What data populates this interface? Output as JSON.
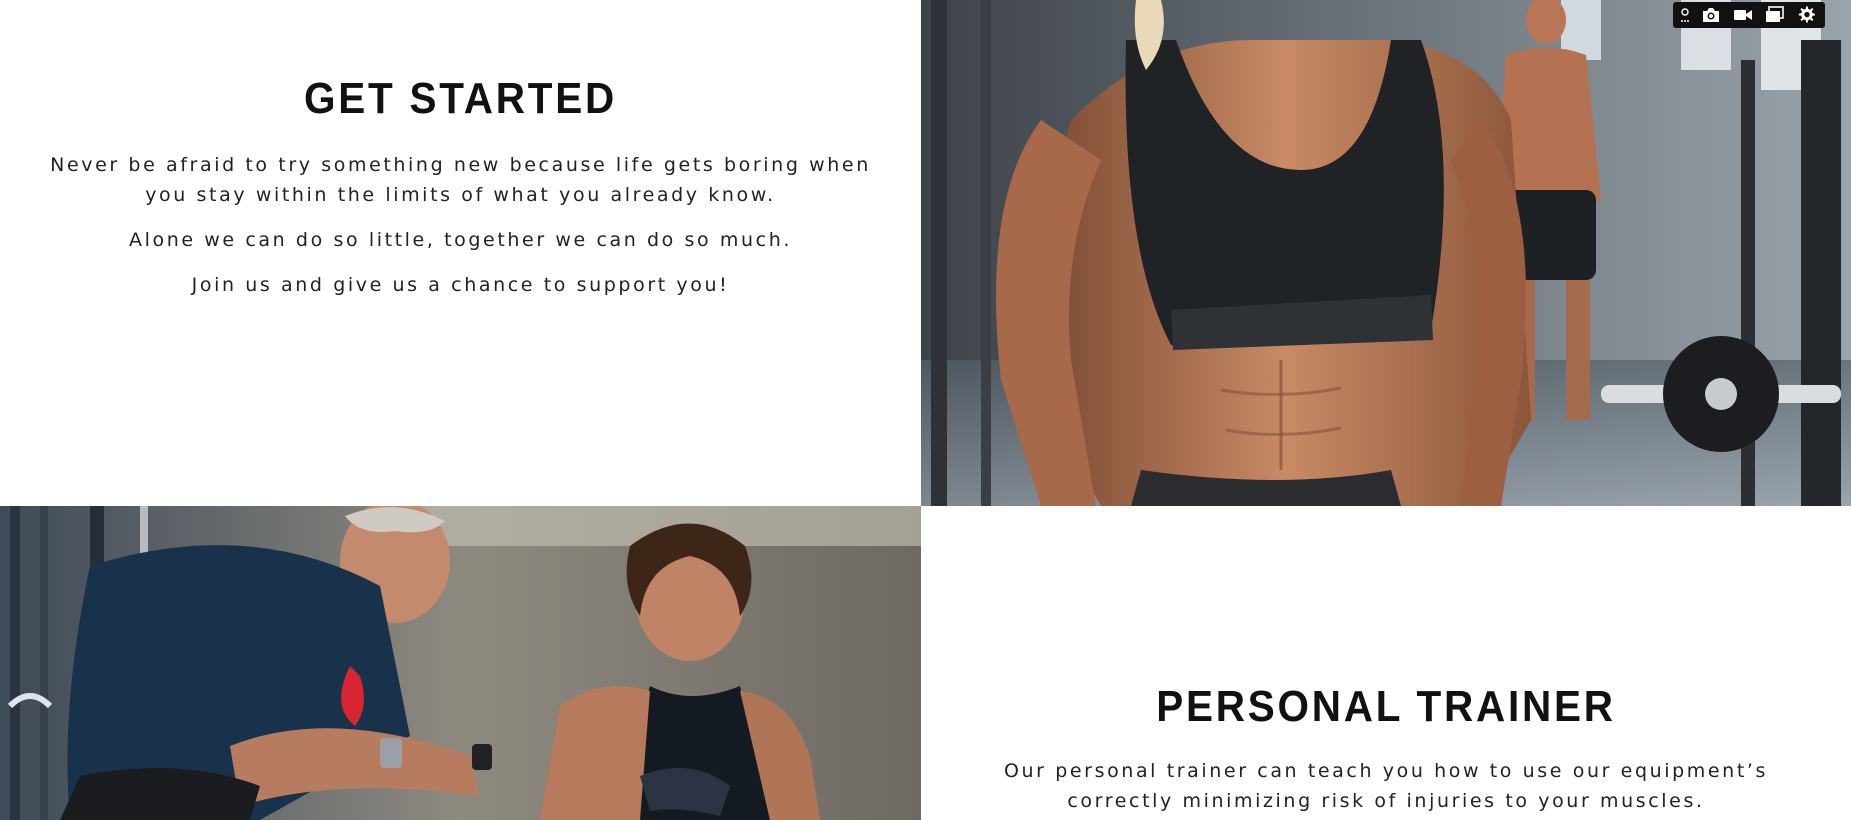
{
  "section_get_started": {
    "title": "GET STARTED",
    "paragraphs": [
      "Never be afraid to try something new because life gets boring when you stay within the limits of what you already know.",
      "Alone we can do so little, together we can do so much.",
      "Join us and give us a chance to support you!"
    ]
  },
  "section_personal_trainer": {
    "title": "PERSONAL TRAINER",
    "paragraphs": [
      "Our personal trainer can teach you how to use our equipment’s correctly minimizing risk of injuries to your muscles."
    ]
  },
  "photos": {
    "top_right": "woman-in-sports-bra-gym-photo",
    "bottom_left": "trainer-and-client-laughing-photo"
  },
  "toolbar": {
    "icons": [
      "settings-small-icon",
      "camera-icon",
      "video-icon",
      "window-icon",
      "gear-icon"
    ]
  },
  "colors": {
    "toolbar_bg": "#111111",
    "heading": "#111111",
    "body_text": "#222222"
  }
}
